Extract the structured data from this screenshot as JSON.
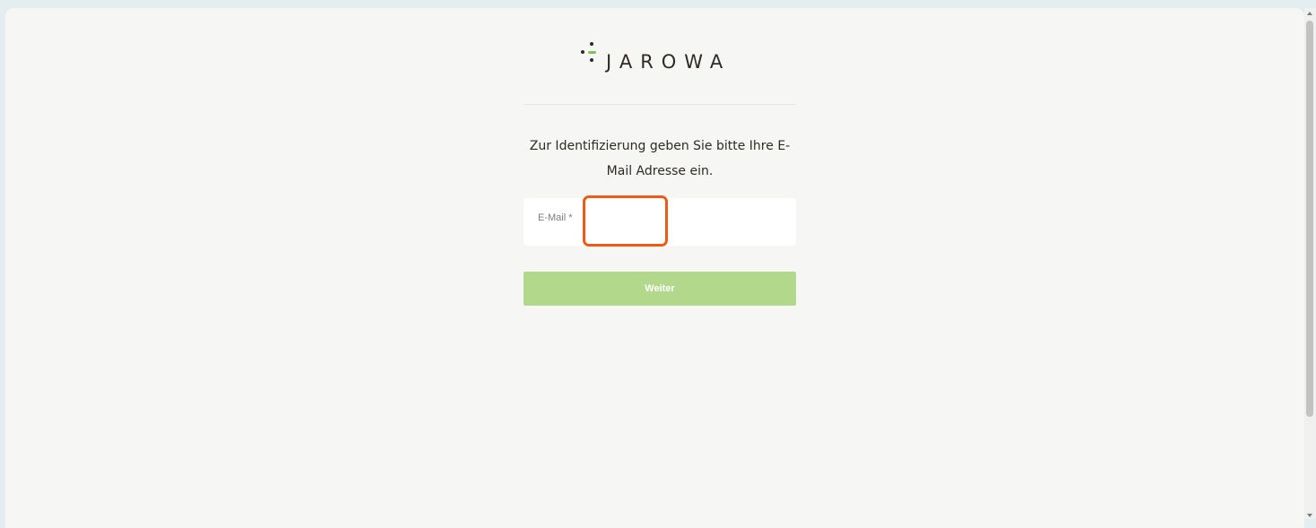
{
  "brand": {
    "name": "JAROWA",
    "logo_icon": "jarowa-dots-logo-icon"
  },
  "form": {
    "instruction": "Zur Identifizierung geben Sie bitte Ihre E-Mail Adresse ein.",
    "email_label": "E-Mail *",
    "email_value": "",
    "submit_label": "Weiter"
  },
  "colors": {
    "background": "#f6f6f4",
    "brand_dark": "#2f2a26",
    "brand_green": "#7cc35a",
    "button_disabled": "#b1d88b",
    "highlight": "#ee5b16"
  }
}
